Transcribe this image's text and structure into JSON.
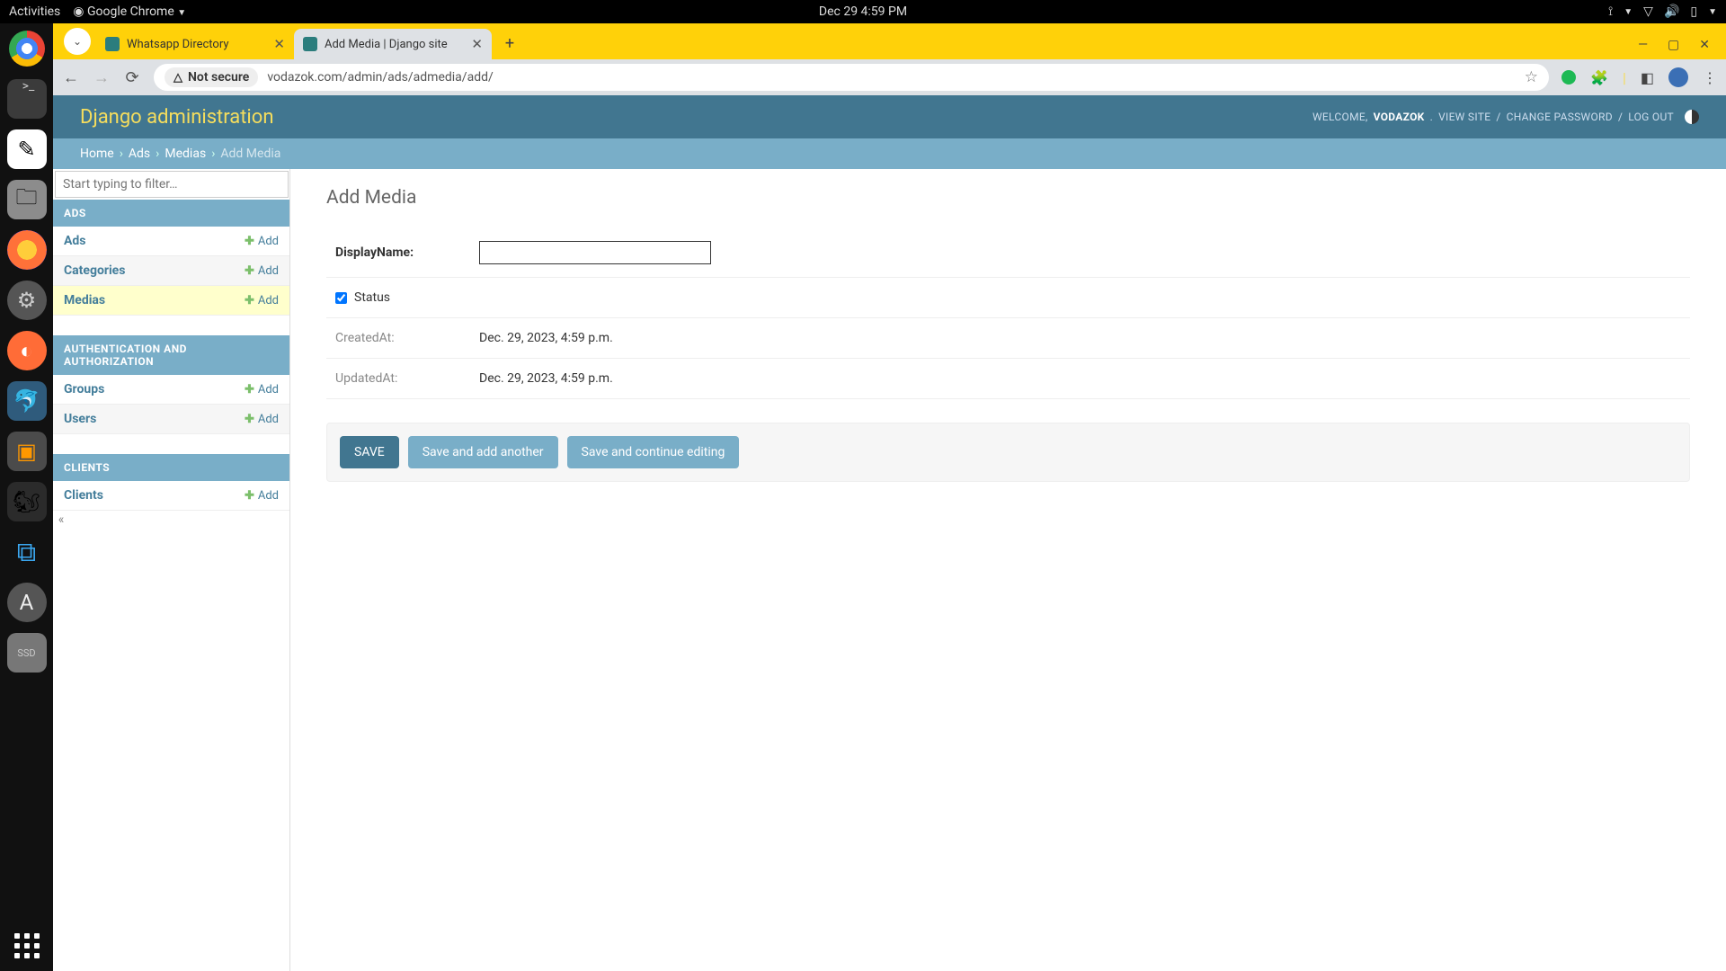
{
  "gnome": {
    "activities": "Activities",
    "app": "Google Chrome",
    "datetime": "Dec 29  4:59 PM"
  },
  "chrome": {
    "tabs": [
      {
        "title": "Whatsapp Directory",
        "active": false
      },
      {
        "title": "Add Media | Django site",
        "active": true
      }
    ],
    "security_label": "Not secure",
    "url": "vodazok.com/admin/ads/admedia/add/"
  },
  "django": {
    "brand": "Django administration",
    "welcome_prefix": "WELCOME, ",
    "username": "VODAZOK",
    "links": {
      "view_site": "VIEW SITE",
      "change_password": "CHANGE PASSWORD",
      "log_out": "LOG OUT"
    }
  },
  "breadcrumbs": {
    "home": "Home",
    "app": "Ads",
    "model": "Medias",
    "current": "Add Media"
  },
  "sidebar": {
    "filter_placeholder": "Start typing to filter…",
    "add_label": "Add",
    "sections": [
      {
        "title": "ADS",
        "models": [
          {
            "name": "Ads"
          },
          {
            "name": "Categories"
          },
          {
            "name": "Medias",
            "selected": true
          }
        ]
      },
      {
        "title": "AUTHENTICATION AND AUTHORIZATION",
        "models": [
          {
            "name": "Groups"
          },
          {
            "name": "Users"
          }
        ]
      },
      {
        "title": "CLIENTS",
        "models": [
          {
            "name": "Clients"
          }
        ]
      }
    ],
    "collapse": "«"
  },
  "form": {
    "title": "Add Media",
    "fields": {
      "displayname_label": "DisplayName:",
      "displayname_value": "",
      "status_label": "Status",
      "status_checked": true,
      "createdat_label": "CreatedAt:",
      "createdat_value": "Dec. 29, 2023, 4:59 p.m.",
      "updatedat_label": "UpdatedAt:",
      "updatedat_value": "Dec. 29, 2023, 4:59 p.m."
    },
    "buttons": {
      "save": "SAVE",
      "save_add": "Save and add another",
      "save_continue": "Save and continue editing"
    }
  }
}
